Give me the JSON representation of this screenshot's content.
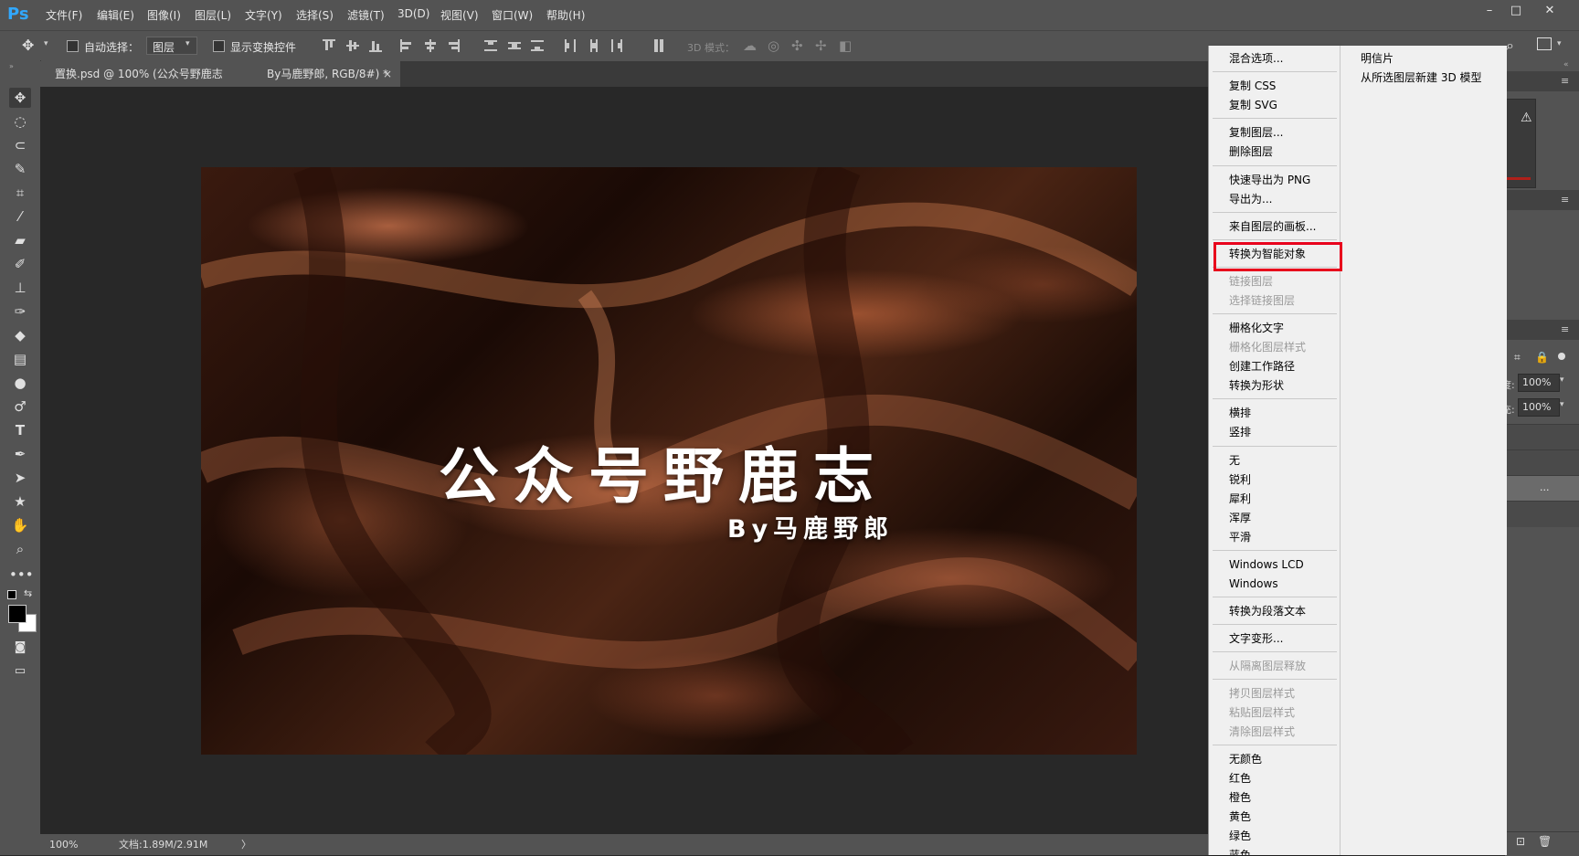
{
  "app": {
    "logo": "Ps"
  },
  "menubar": {
    "items": [
      "文件(F)",
      "编辑(E)",
      "图像(I)",
      "图层(L)",
      "文字(Y)",
      "选择(S)",
      "滤镜(T)",
      "3D(D)",
      "视图(V)",
      "窗口(W)",
      "帮助(H)"
    ]
  },
  "window_controls": {
    "minimize": "–",
    "maximize": "□",
    "close": "✕"
  },
  "options_bar": {
    "auto_select_label": "自动选择：",
    "auto_select_value": "图层",
    "show_transform_label": "显示变换控件",
    "mode_3d_label": "3D 模式："
  },
  "tabs": [
    {
      "label": "置换.psd @ 100% (公众号野鹿志"
    },
    {
      "label": "By马鹿野郎, RGB/8#) *",
      "close": "×"
    }
  ],
  "canvas": {
    "title": "公众号野鹿志",
    "byline": "By马鹿野郎"
  },
  "statusbar": {
    "zoom": "100%",
    "doc_info": "文档:1.89M/2.91M",
    "arrow": "〉"
  },
  "right_panel": {
    "opacity_value": "100%",
    "fill_value": "100%",
    "opacity_label": "度:",
    "fill_label": "充:",
    "more": "..."
  },
  "context_menu": {
    "items": [
      {
        "label": "混合选项...",
        "disabled": false
      },
      {
        "label": "复制 CSS",
        "disabled": false
      },
      {
        "label": "复制 SVG",
        "disabled": false
      },
      {
        "label": "复制图层...",
        "disabled": false
      },
      {
        "label": "删除图层",
        "disabled": false
      },
      {
        "label": "快速导出为 PNG",
        "disabled": false
      },
      {
        "label": "导出为...",
        "disabled": false
      },
      {
        "label": "来自图层的画板...",
        "disabled": false
      },
      {
        "label": "转换为智能对象",
        "disabled": false,
        "highlighted": true
      },
      {
        "label": "链接图层",
        "disabled": true
      },
      {
        "label": "选择链接图层",
        "disabled": true
      },
      {
        "label": "栅格化文字",
        "disabled": false
      },
      {
        "label": "栅格化图层样式",
        "disabled": true
      },
      {
        "label": "创建工作路径",
        "disabled": false
      },
      {
        "label": "转换为形状",
        "disabled": false
      },
      {
        "label": "横排",
        "disabled": false
      },
      {
        "label": "竖排",
        "disabled": false
      },
      {
        "label": "无",
        "disabled": false
      },
      {
        "label": "锐利",
        "disabled": false
      },
      {
        "label": "犀利",
        "disabled": false
      },
      {
        "label": "浑厚",
        "disabled": false
      },
      {
        "label": "平滑",
        "disabled": false
      },
      {
        "label": "Windows LCD",
        "disabled": false
      },
      {
        "label": "Windows",
        "disabled": false
      },
      {
        "label": "转换为段落文本",
        "disabled": false
      },
      {
        "label": "文字变形...",
        "disabled": false
      },
      {
        "label": "从隔离图层释放",
        "disabled": true
      },
      {
        "label": "拷贝图层样式",
        "disabled": true
      },
      {
        "label": "粘贴图层样式",
        "disabled": true
      },
      {
        "label": "清除图层样式",
        "disabled": true
      },
      {
        "label": "无颜色",
        "disabled": false
      },
      {
        "label": "红色",
        "disabled": false
      },
      {
        "label": "橙色",
        "disabled": false
      },
      {
        "label": "黄色",
        "disabled": false
      },
      {
        "label": "绿色",
        "disabled": false
      },
      {
        "label": "蓝色",
        "disabled": false
      }
    ],
    "submenu": [
      {
        "label": "明信片"
      },
      {
        "label": "从所选图层新建 3D 模型"
      }
    ]
  },
  "colors": {
    "accent_highlight": "#e8001c",
    "ps_blue": "#31a8ff",
    "panel_gray": "#535353",
    "canvas_bg": "#282828"
  }
}
